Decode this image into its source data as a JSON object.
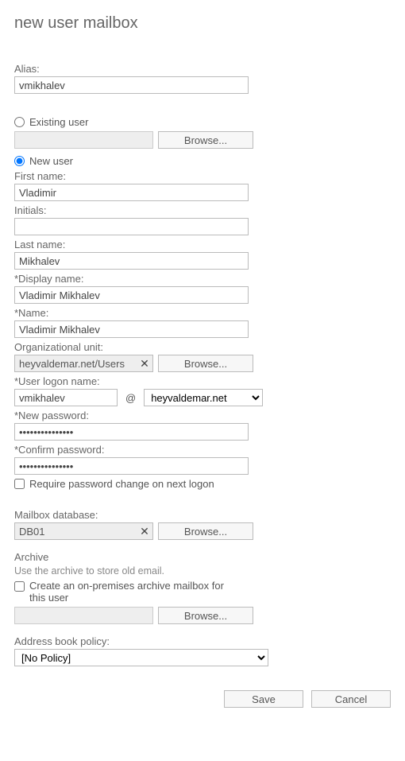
{
  "title": "new user mailbox",
  "alias": {
    "label": "Alias:",
    "value": "vmikhalev"
  },
  "userSource": {
    "existing": {
      "label": "Existing user",
      "selected": false,
      "browse": "Browse..."
    },
    "newUser": {
      "label": "New user",
      "selected": true
    }
  },
  "firstName": {
    "label": "First name:",
    "value": "Vladimir"
  },
  "initials": {
    "label": "Initials:",
    "value": ""
  },
  "lastName": {
    "label": "Last name:",
    "value": "Mikhalev"
  },
  "displayName": {
    "label": "*Display name:",
    "value": "Vladimir Mikhalev"
  },
  "name": {
    "label": "*Name:",
    "value": "Vladimir Mikhalev"
  },
  "orgUnit": {
    "label": "Organizational unit:",
    "value": "heyvaldemar.net/Users",
    "browse": "Browse..."
  },
  "logon": {
    "label": "*User logon name:",
    "value": "vmikhalev",
    "domain": "heyvaldemar.net"
  },
  "newPassword": {
    "label": "*New password:",
    "value": "•••••••••••••••"
  },
  "confirmPassword": {
    "label": "*Confirm password:",
    "value": "•••••••••••••••"
  },
  "requireChange": {
    "label": "Require password change on next logon",
    "checked": false
  },
  "mailboxDb": {
    "label": "Mailbox database:",
    "value": "DB01",
    "browse": "Browse..."
  },
  "archive": {
    "title": "Archive",
    "hint": "Use the archive to store old email.",
    "optLabel": "Create an on-premises archive mailbox for this user",
    "checked": false,
    "browse": "Browse..."
  },
  "abp": {
    "label": "Address book policy:",
    "value": "[No Policy]"
  },
  "buttons": {
    "save": "Save",
    "cancel": "Cancel"
  }
}
